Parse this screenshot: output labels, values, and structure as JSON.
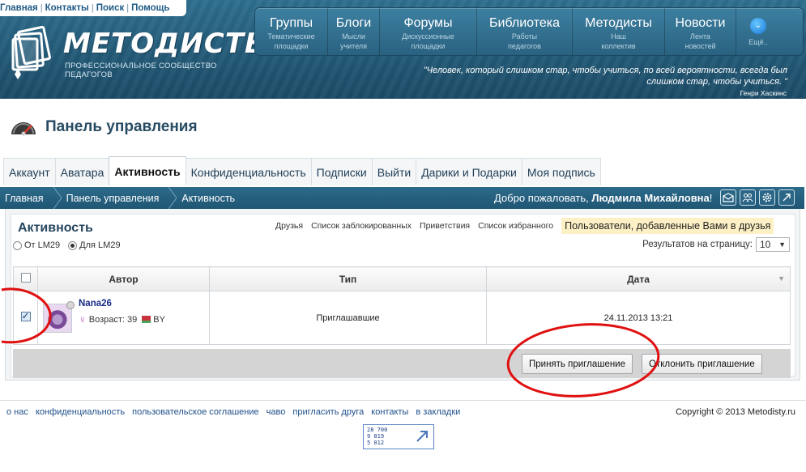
{
  "topbar": {
    "links": [
      "Главная",
      "Контакты",
      "Поиск",
      "Помощь"
    ]
  },
  "logo": {
    "text": "МЕТОДИСТЫ",
    "subtitle": "ПРОФЕССИОНАЛЬНОЕ СООБЩЕСТВО ПЕДАГОГОВ"
  },
  "nav": [
    {
      "title": "Группы",
      "sub1": "Тематические",
      "sub2": "площадки"
    },
    {
      "title": "Блоги",
      "sub1": "Мысли",
      "sub2": "учителя"
    },
    {
      "title": "Форумы",
      "sub1": "Дискуссионные",
      "sub2": "площадки"
    },
    {
      "title": "Библиотека",
      "sub1": "Работы",
      "sub2": "педагогов"
    },
    {
      "title": "Методисты",
      "sub1": "Наш",
      "sub2": "коллектив"
    },
    {
      "title": "Новости",
      "sub1": "Лента",
      "sub2": "новостей"
    }
  ],
  "nav_more": "Ещё..",
  "quote": {
    "line1": "\"Человек, который слишком стар, чтобы учиться, по всей вероятности, всегда был",
    "line2": "слишком стар, чтобы учиться. \"",
    "author": "Генри Хаскинс"
  },
  "panel_title": "Панель управления",
  "tabs": [
    "Аккаунт",
    "Аватара",
    "Активность",
    "Конфиденциальность",
    "Подписки",
    "Выйти",
    "Дарики и Подарки",
    "Моя подпись"
  ],
  "breadcrumb": [
    "Главная",
    "Панель управления",
    "Активность"
  ],
  "welcome": {
    "prefix": "Добро пожаловать, ",
    "name": "Людмила Михайловна",
    "suffix": "!"
  },
  "section_title": "Активность",
  "sublinks": [
    "Друзья",
    "Список заблокированных",
    "Приветствия",
    "Список избранного"
  ],
  "sublink_active": "Пользователи, добавленные Вами в друзья",
  "filters": {
    "from": "От LM29",
    "to": "Для LM29",
    "selected": "to"
  },
  "per_page": {
    "label": "Результатов на страницу:",
    "value": "10"
  },
  "table": {
    "headers": [
      "Автор",
      "Тип",
      "Дата"
    ],
    "rows": [
      {
        "checked": true,
        "author": "Nana26",
        "age_label": "Возраст: 39",
        "country": "BY",
        "type": "Приглашавшие",
        "date": "24.11.2013 13:21"
      }
    ]
  },
  "buttons": {
    "accept": "Принять приглашение",
    "decline": "Отклонить приглашение"
  },
  "footer": {
    "links": [
      "о нас",
      "конфиденциальность",
      "пользовательское соглашение",
      "чаво",
      "пригласить друга",
      "контакты",
      "в закладки"
    ],
    "copyright": "Copyright © 2013 Metodisty.ru"
  },
  "counter": {
    "line1": "28 700",
    "line2": "9 819",
    "line3": "5 012"
  },
  "colors": {
    "header": "#235a77",
    "annotation": "#e01010",
    "highlight": "#fdf0c4"
  }
}
